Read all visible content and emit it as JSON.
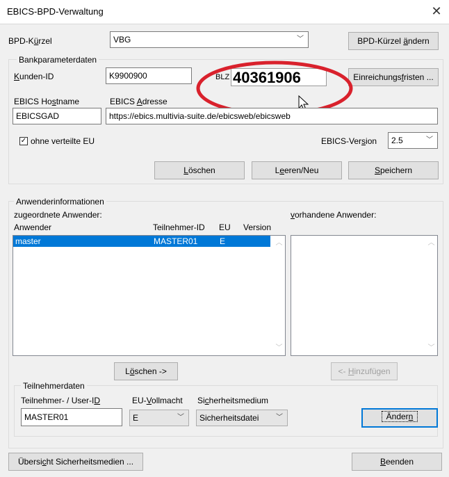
{
  "window": {
    "title": "EBICS-BPD-Verwaltung",
    "close_glyph": "✕"
  },
  "bpd": {
    "label": "BPD-Kürzel",
    "value": "VBG",
    "change_button": "BPD-Kürzel ändern"
  },
  "bank": {
    "group_label": "Bankparameterdaten",
    "kunden_id_label": "Kunden-ID",
    "kunden_id_value": "K9900900",
    "blz_label": "BLZ",
    "blz_value": "40361906",
    "fristen_button": "Einreichungsfristen ...",
    "hostname_label": "EBICS Hostname",
    "hostname_value": "EBICSGAD",
    "adresse_label": "EBICS Adresse",
    "adresse_value": "https://ebics.multivia-suite.de/ebicsweb/ebicsweb",
    "ohne_eu_label": "ohne verteilte EU",
    "ohne_eu_checked": true,
    "version_label": "EBICS-Version",
    "version_value": "2.5",
    "loeschen_button": "Löschen",
    "leeren_button": "Leeren/Neu",
    "speichern_button": "Speichern"
  },
  "anwender": {
    "group_label": "Anwenderinformationen",
    "zugeordnet_label": "zugeordnete Anwender:",
    "vorhanden_label": "vorhandene Anwender:",
    "columns": [
      "Anwender",
      "Teilnehmer-ID",
      "EU",
      "Version"
    ],
    "rows": [
      {
        "anwender": "master",
        "teilnehmer_id": "MASTER01",
        "eu": "E",
        "version": ""
      }
    ],
    "loeschen_button": "Löschen ->",
    "hinzufuegen_button": "<- Hinzufügen"
  },
  "teilnehmer": {
    "group_label": "Teilnehmerdaten",
    "user_id_label": "Teilnehmer- / User-ID",
    "user_id_value": "MASTER01",
    "vollmacht_label": "EU-Vollmacht",
    "vollmacht_value": "E",
    "medium_label": "Sicherheitsmedium",
    "medium_value": "Sicherheitsdatei",
    "aendern_button": "Ändern"
  },
  "footer": {
    "uebersicht_button": "Übersicht Sicherheitsmedien ...",
    "beenden_button": "Beenden"
  },
  "colors": {
    "highlight_ellipse": "#d9212c",
    "selection": "#0078d7",
    "accent": "#0078d7"
  }
}
